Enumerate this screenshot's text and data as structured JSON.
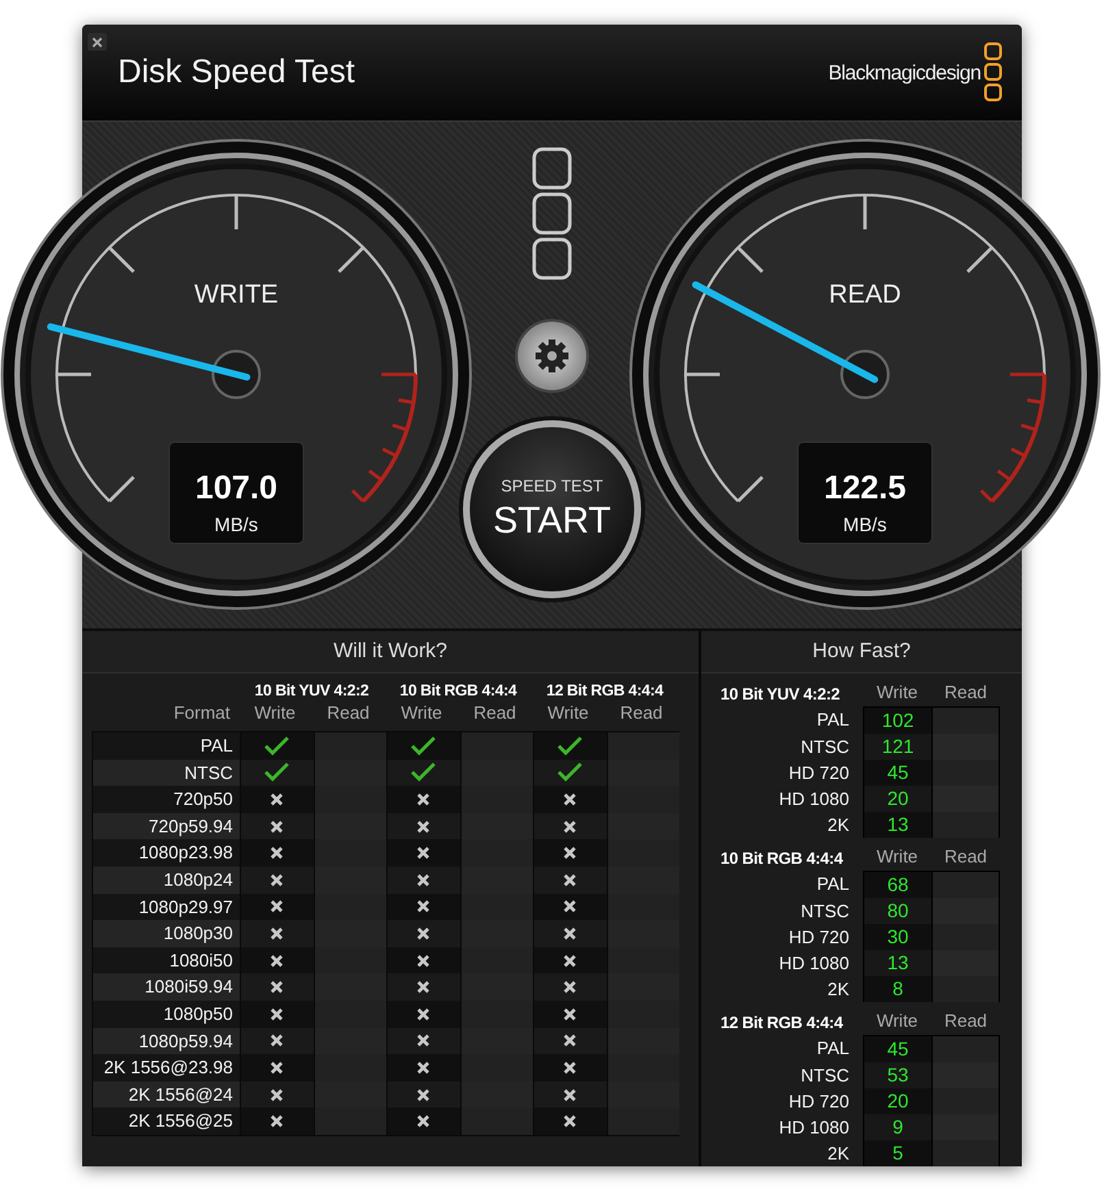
{
  "window": {
    "title": "Disk Speed Test",
    "brand": "Blackmagicdesign"
  },
  "gauges": [
    {
      "label": "WRITE",
      "value": "107.0",
      "unit": "MB/s",
      "level": 0.22
    },
    {
      "label": "READ",
      "value": "122.5",
      "unit": "MB/s",
      "level": 0.27
    }
  ],
  "start_button": {
    "caption": "SPEED TEST",
    "label": "START"
  },
  "will_it_work": {
    "title": "Will it Work?",
    "format_heading": "Format",
    "groups": [
      {
        "name": "10 Bit YUV 4:2:2",
        "columns": [
          "Write",
          "Read"
        ]
      },
      {
        "name": "10 Bit RGB 4:4:4",
        "columns": [
          "Write",
          "Read"
        ]
      },
      {
        "name": "12 Bit RGB 4:4:4",
        "columns": [
          "Write",
          "Read"
        ]
      }
    ],
    "rows": [
      {
        "format": "PAL",
        "write_ok": [
          true,
          true,
          true
        ]
      },
      {
        "format": "NTSC",
        "write_ok": [
          true,
          true,
          true
        ]
      },
      {
        "format": "720p50",
        "write_ok": [
          false,
          false,
          false
        ]
      },
      {
        "format": "720p59.94",
        "write_ok": [
          false,
          false,
          false
        ]
      },
      {
        "format": "1080p23.98",
        "write_ok": [
          false,
          false,
          false
        ]
      },
      {
        "format": "1080p24",
        "write_ok": [
          false,
          false,
          false
        ]
      },
      {
        "format": "1080p29.97",
        "write_ok": [
          false,
          false,
          false
        ]
      },
      {
        "format": "1080p30",
        "write_ok": [
          false,
          false,
          false
        ]
      },
      {
        "format": "1080i50",
        "write_ok": [
          false,
          false,
          false
        ]
      },
      {
        "format": "1080i59.94",
        "write_ok": [
          false,
          false,
          false
        ]
      },
      {
        "format": "1080p50",
        "write_ok": [
          false,
          false,
          false
        ]
      },
      {
        "format": "1080p59.94",
        "write_ok": [
          false,
          false,
          false
        ]
      },
      {
        "format": "2K 1556@23.98",
        "write_ok": [
          false,
          false,
          false
        ]
      },
      {
        "format": "2K 1556@24",
        "write_ok": [
          false,
          false,
          false
        ]
      },
      {
        "format": "2K 1556@25",
        "write_ok": [
          false,
          false,
          false
        ]
      }
    ]
  },
  "how_fast": {
    "title": "How Fast?",
    "sections": [
      {
        "name": "10 Bit YUV 4:2:2",
        "columns": [
          "Write",
          "Read"
        ],
        "rows": [
          {
            "format": "PAL",
            "write": "102"
          },
          {
            "format": "NTSC",
            "write": "121"
          },
          {
            "format": "HD 720",
            "write": "45"
          },
          {
            "format": "HD 1080",
            "write": "20"
          },
          {
            "format": "2K",
            "write": "13"
          }
        ]
      },
      {
        "name": "10 Bit RGB 4:4:4",
        "columns": [
          "Write",
          "Read"
        ],
        "rows": [
          {
            "format": "PAL",
            "write": "68"
          },
          {
            "format": "NTSC",
            "write": "80"
          },
          {
            "format": "HD 720",
            "write": "30"
          },
          {
            "format": "HD 1080",
            "write": "13"
          },
          {
            "format": "2K",
            "write": "8"
          }
        ]
      },
      {
        "name": "12 Bit RGB 4:4:4",
        "columns": [
          "Write",
          "Read"
        ],
        "rows": [
          {
            "format": "PAL",
            "write": "45"
          },
          {
            "format": "NTSC",
            "write": "53"
          },
          {
            "format": "HD 720",
            "write": "20"
          },
          {
            "format": "HD 1080",
            "write": "9"
          },
          {
            "format": "2K",
            "write": "5"
          }
        ]
      }
    ]
  }
}
